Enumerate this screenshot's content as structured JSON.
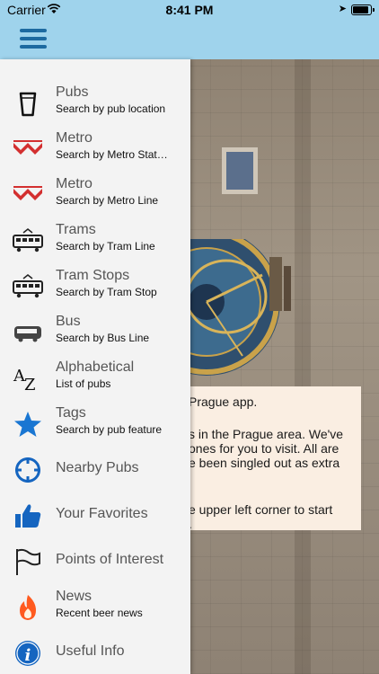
{
  "status_bar": {
    "carrier": "Carrier",
    "time": "8:41 PM"
  },
  "colors": {
    "nav_bar": "#9fd3ec",
    "menu_icon": "#1d6aa0",
    "metro_red": "#d32f2f",
    "accent_blue": "#1976d2",
    "news_orange": "#ff5a1f"
  },
  "menu": {
    "items": [
      {
        "title": "Pubs",
        "subtitle": "Search by pub location",
        "icon": "beer-glass-icon"
      },
      {
        "title": "Metro",
        "subtitle": "Search by Metro Stat…",
        "icon": "metro-logo-icon"
      },
      {
        "title": "Metro",
        "subtitle": "Search by Metro Line",
        "icon": "metro-logo-icon"
      },
      {
        "title": "Trams",
        "subtitle": "Search by Tram Line",
        "icon": "tram-icon"
      },
      {
        "title": "Tram Stops",
        "subtitle": "Search by Tram Stop",
        "icon": "tram-icon"
      },
      {
        "title": "Bus",
        "subtitle": "Search by Bus Line",
        "icon": "bus-icon"
      },
      {
        "title": "Alphabetical",
        "subtitle": "List of pubs",
        "icon": "az-sort-icon"
      },
      {
        "title": "Tags",
        "subtitle": "Search by pub feature",
        "icon": "star-icon"
      },
      {
        "title": "Nearby Pubs",
        "icon": "crosshair-icon"
      },
      {
        "title": "Your Favorites",
        "icon": "thumbs-up-icon"
      },
      {
        "title": "Points of Interest",
        "icon": "flag-icon"
      },
      {
        "title": "News",
        "subtitle": "Recent beer news",
        "icon": "flame-icon"
      },
      {
        "title": "Useful Info",
        "icon": "info-icon"
      }
    ]
  },
  "welcome_card": {
    "line1": "Prague app.",
    "line2": "s in the Prague area. We've",
    "line3": "ones for you to visit. All are",
    "line4": "e been singled out as extra",
    "line5": "e upper left corner to start",
    "line6": "."
  }
}
